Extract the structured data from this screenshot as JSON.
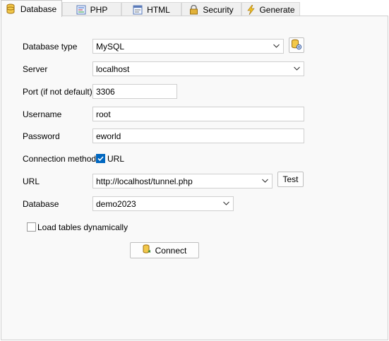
{
  "tabs": [
    {
      "label": "Database",
      "icon": "database-icon",
      "active": true
    },
    {
      "label": "PHP",
      "icon": "php-icon",
      "active": false
    },
    {
      "label": "HTML",
      "icon": "html-icon",
      "active": false
    },
    {
      "label": "Security",
      "icon": "lock-icon",
      "active": false
    },
    {
      "label": "Generate",
      "icon": "lightning-icon",
      "active": false
    }
  ],
  "form": {
    "db_type": {
      "label": "Database type",
      "value": "MySQL"
    },
    "server": {
      "label": "Server",
      "value": "localhost"
    },
    "port": {
      "label": "Port (if not default)",
      "value": "3306"
    },
    "username": {
      "label": "Username",
      "value": "root"
    },
    "password": {
      "label": "Password",
      "value": "eworld"
    },
    "connection_method": {
      "label": "Connection method",
      "option_label": "URL",
      "checked": true
    },
    "url": {
      "label": "URL",
      "value": "http://localhost/tunnel.php",
      "test_label": "Test"
    },
    "database": {
      "label": "Database",
      "value": "demo2023"
    },
    "load_tables": {
      "label": "Load tables dynamically",
      "checked": false
    }
  },
  "connect_button": {
    "label": "Connect"
  },
  "colors": {
    "accent": "#0067c0",
    "panel_bg": "#f9f9f9",
    "tab_bg": "#f0f0f0"
  }
}
